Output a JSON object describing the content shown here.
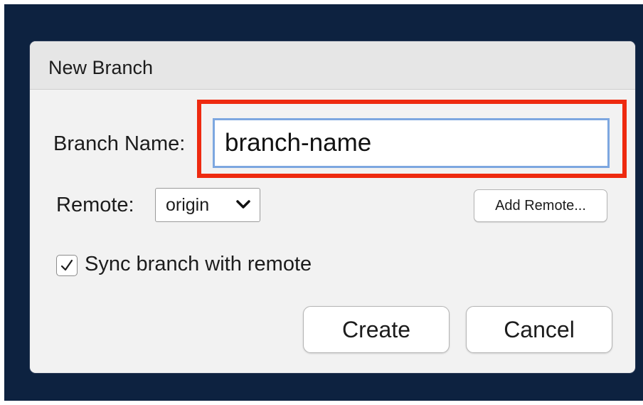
{
  "dialog": {
    "title": "New Branch",
    "branch_name": {
      "label": "Branch Name:",
      "value": "branch-name"
    },
    "remote": {
      "label": "Remote:",
      "selected": "origin",
      "add_remote_label": "Add Remote..."
    },
    "sync": {
      "label": "Sync branch with remote",
      "checked": true
    },
    "buttons": {
      "create_label": "Create",
      "cancel_label": "Cancel"
    }
  },
  "colors": {
    "backdrop": "#0d2240",
    "highlight": "#ee2a10",
    "input_focus": "#7da7e0",
    "dialog_bg": "#f2f2f2"
  },
  "icons": {
    "dropdown": "chevron-down-icon",
    "check": "checkmark-icon"
  }
}
